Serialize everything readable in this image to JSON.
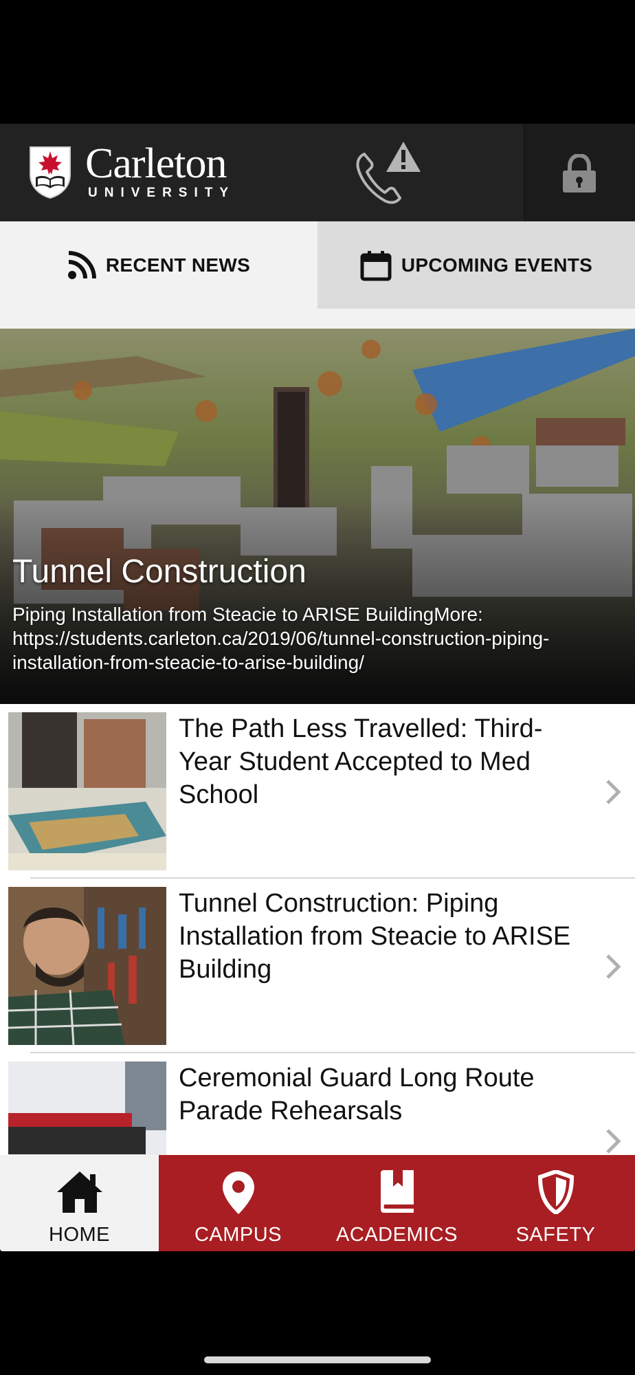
{
  "header": {
    "brand_name": "Carleton",
    "brand_sub": "UNIVERSITY"
  },
  "tabs": [
    {
      "label": "RECENT NEWS",
      "icon": "rss-icon",
      "selected": true
    },
    {
      "label": "UPCOMING EVENTS",
      "icon": "calendar-icon",
      "selected": false
    }
  ],
  "featured": {
    "title": "Tunnel Construction",
    "description": "Piping Installation from Steacie to ARISE BuildingMore: https://students.carleton.ca/2019/06/tunnel-construction-piping-installation-from-steacie-to-arise-building/"
  },
  "news": [
    {
      "title": "The Path Less Travelled: Third-Year Student Accepted to Med School"
    },
    {
      "title": "Tunnel Construction: Piping Installation from Steacie to ARISE Building"
    },
    {
      "title": "Ceremonial Guard Long Route Parade Rehearsals"
    }
  ],
  "bottom_nav": [
    {
      "label": "HOME",
      "icon": "home-icon",
      "selected": true
    },
    {
      "label": "CAMPUS",
      "icon": "map-pin-icon",
      "selected": false
    },
    {
      "label": "ACADEMICS",
      "icon": "book-icon",
      "selected": false
    },
    {
      "label": "SAFETY",
      "icon": "shield-icon",
      "selected": false
    }
  ],
  "colors": {
    "brand_red": "#a81e22",
    "header_bg": "#222222",
    "tab_selected_bg": "#f2f2f2",
    "tab_unselected_bg": "#dcdcdc"
  }
}
